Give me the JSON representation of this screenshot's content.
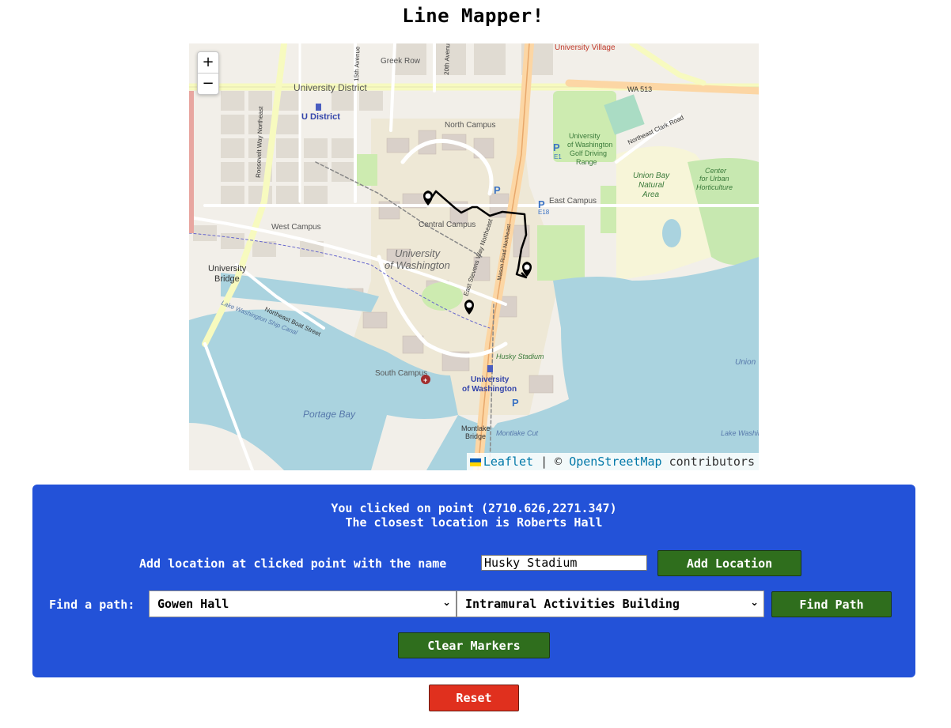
{
  "page": {
    "title": "Line Mapper!"
  },
  "map": {
    "zoom_in": "+",
    "zoom_out": "−",
    "labels": {
      "university_district": "University District",
      "u_district_station": "U District",
      "greek_row": "Greek Row",
      "university_village": "University Village",
      "wa513": "WA 513",
      "north_campus": "North Campus",
      "golf_range": "University of Washington Golf Driving Range",
      "ne_clark_road": "Northeast Clark Road",
      "union_bay": "Union Bay Natural Area",
      "center_urban_hort": "Center for Urban Horticulture",
      "east_campus": "East Campus",
      "west_campus": "West Campus",
      "central_campus": "Central Campus",
      "uw_big": "University of Washington",
      "university_bridge": "University Bridge",
      "ne_boat_street": "Northeast Boat Street",
      "lake_washington_ship_canal": "Lake Washington Ship Canal",
      "south_campus": "South Campus",
      "uw_station": "University of Washington",
      "husky_stadium": "Husky Stadium",
      "portage_bay": "Portage Bay",
      "montlake_bridge": "Montlake Bridge",
      "montlake_cut": "Montlake Cut",
      "union_bay_water": "Union",
      "lake_washington": "Lake Washin",
      "roosevelt_way": "Roosevelt Way Northeast",
      "fifteenth_ave": "15th Avenue",
      "twentieth_ave": "20th Avenue",
      "stevens_way": "East Stevens Way Northeast",
      "mason_road": "Mason Road Northeast",
      "parking_e1": "E1",
      "parking_e18": "E18",
      "parking_p": "P"
    },
    "attribution": {
      "leaflet": "Leaflet",
      "separator": "|",
      "copyright": "©",
      "osm": "OpenStreetMap",
      "contributors": "contributors"
    }
  },
  "panel": {
    "clicked_message": "You clicked on point (2710.626,2271.347)",
    "closest_message": "The closest location is Roberts Hall",
    "add_location_label": "Add location at clicked point with the name",
    "location_name_value": "Husky Stadium",
    "add_location_button": "Add Location",
    "find_path_label": "Find a path:",
    "path_start": "Gowen Hall",
    "path_end": "Intramural Activities Building",
    "find_path_button": "Find Path",
    "clear_markers_button": "Clear Markers"
  },
  "reset_button": "Reset",
  "colors": {
    "panel_bg": "#2352d8",
    "button_green": "#2f6e1d",
    "reset_red": "#e0301e",
    "water": "#aad3df",
    "route": "#000000"
  }
}
